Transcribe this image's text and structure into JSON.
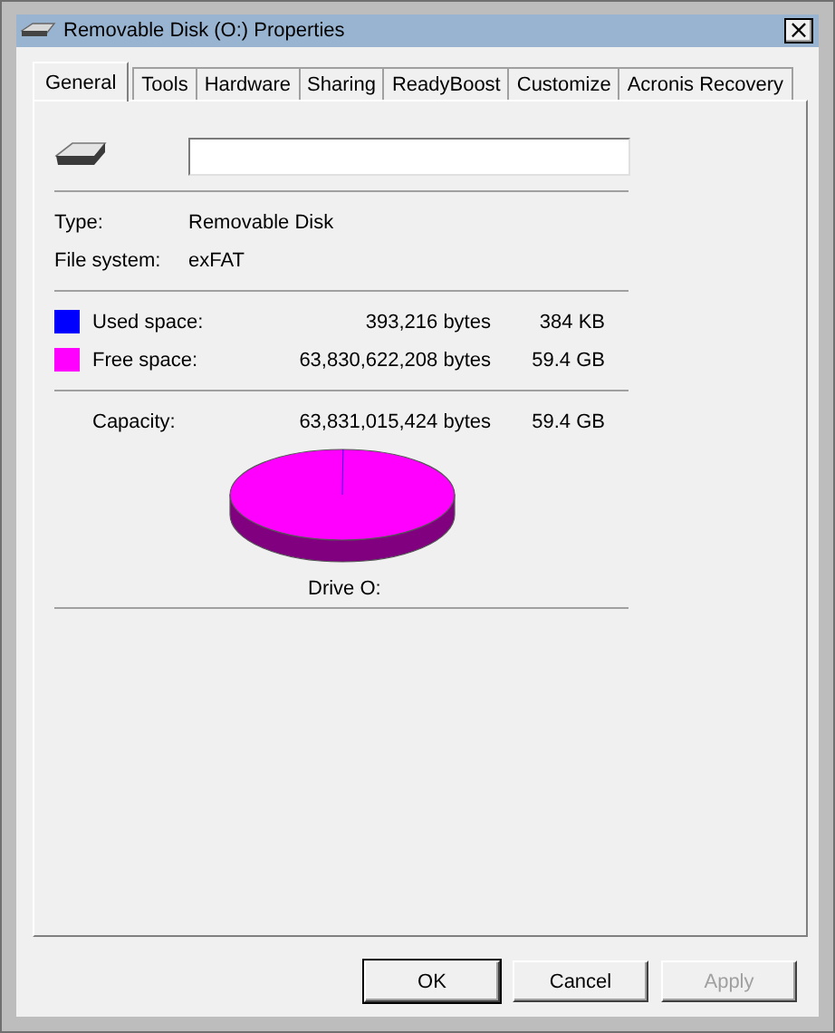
{
  "window": {
    "title": "Removable Disk (O:) Properties",
    "close": "×"
  },
  "tabs": [
    {
      "label": "General",
      "selected": true
    },
    {
      "label": "Tools",
      "selected": false
    },
    {
      "label": "Hardware",
      "selected": false
    },
    {
      "label": "Sharing",
      "selected": false
    },
    {
      "label": "ReadyBoost",
      "selected": false
    },
    {
      "label": "Customize",
      "selected": false
    },
    {
      "label": "Acronis Recovery",
      "selected": false
    }
  ],
  "properties": [
    {
      "label": "Type:",
      "value": "Removable Disk"
    },
    {
      "label": "File system:",
      "value": "exFAT"
    }
  ],
  "space": [
    {
      "label": "Used space:",
      "bytes": "393,216 bytes",
      "size": "384 KB",
      "color": "#0000ff"
    },
    {
      "label": "Free space:",
      "bytes": "63,830,622,208 bytes",
      "size": "59.4 GB",
      "color": "#ff00ff"
    }
  ],
  "capacity": {
    "label": "Capacity:",
    "bytes": "63,831,015,424 bytes",
    "size": "59.4 GB"
  },
  "drive_label": "Drive O:",
  "buttons": [
    {
      "label": "OK",
      "default": true,
      "disabled": false
    },
    {
      "label": "Cancel",
      "default": false,
      "disabled": false
    },
    {
      "label": "Apply",
      "default": false,
      "disabled": true
    }
  ]
}
